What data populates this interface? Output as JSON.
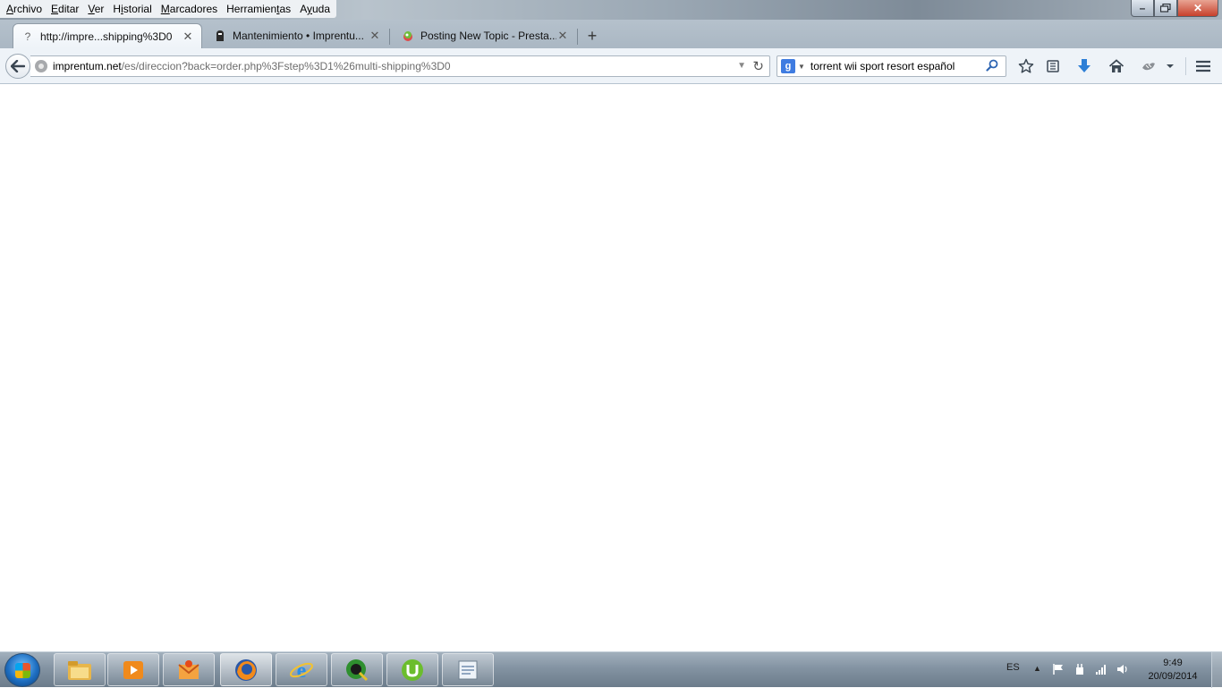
{
  "menu": {
    "items": [
      {
        "label": "Archivo",
        "accel_index": 0
      },
      {
        "label": "Editar",
        "accel_index": 0
      },
      {
        "label": "Ver",
        "accel_index": 0
      },
      {
        "label": "Historial",
        "accel_index": 1
      },
      {
        "label": "Marcadores",
        "accel_index": 0
      },
      {
        "label": "Herramientas",
        "accel_index": 9
      },
      {
        "label": "Ayuda",
        "accel_index": 1
      }
    ]
  },
  "window_controls": {
    "minimize": "minimize-icon",
    "maximize": "maximize-icon",
    "close": "close-icon"
  },
  "tabs": [
    {
      "title": "http://impre...shipping%3D0",
      "icon": "unknown-page-icon",
      "active": true
    },
    {
      "title": "Mantenimiento • Imprentu...",
      "icon": "site-favicon-icon",
      "active": false
    },
    {
      "title": "Posting New Topic - Presta...",
      "icon": "prestashop-favicon-icon",
      "active": false
    }
  ],
  "new_tab_label": "+",
  "urlbar": {
    "host": "imprentum.net",
    "path": "/es/direccion?back=order.php%3Fstep%3D1%26multi-shipping%3D0"
  },
  "search": {
    "engine": "Google",
    "engine_glyph": "g",
    "query": "torrent wii sport resort español"
  },
  "toolbar_icons": [
    "bookmark-star-icon",
    "reading-list-icon",
    "downloads-icon",
    "home-icon",
    "addon-icon",
    "dropdown-icon",
    "menu-icon"
  ],
  "taskbar": {
    "apps": [
      "explorer",
      "media-player",
      "mail",
      "firefox",
      "internet-explorer",
      "app-q",
      "utorrent",
      "documents"
    ],
    "tray_language": "ES",
    "clock_time": "9:49",
    "clock_date": "20/09/2014"
  }
}
